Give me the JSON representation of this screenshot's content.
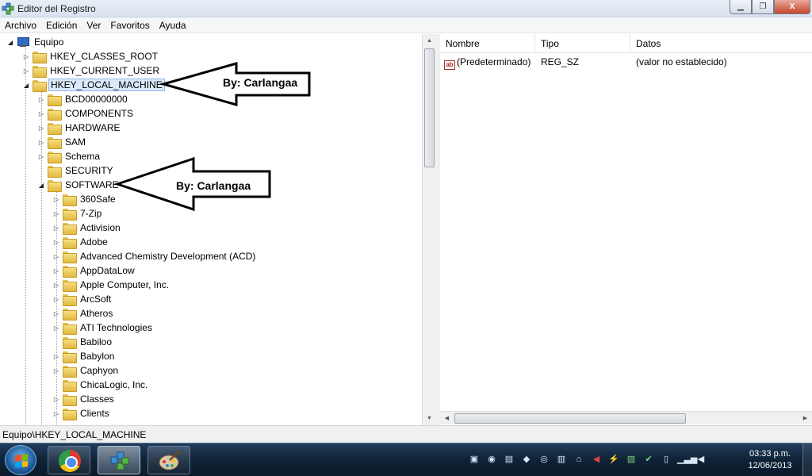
{
  "window": {
    "title": "Editor del Registro",
    "minimize": "▁",
    "maximize": "❐",
    "close": "X"
  },
  "menu": [
    "Archivo",
    "Edición",
    "Ver",
    "Favoritos",
    "Ayuda"
  ],
  "tree": {
    "root": "Equipo",
    "hives": [
      "HKEY_CLASSES_ROOT",
      "HKEY_CURRENT_USER",
      "HKEY_LOCAL_MACHINE"
    ],
    "local_machine_keys": [
      "BCD00000000",
      "COMPONENTS",
      "HARDWARE",
      "SAM",
      "Schema",
      "SECURITY",
      "SOFTWARE"
    ],
    "software_keys": [
      "360Safe",
      "7-Zip",
      "Activision",
      "Adobe",
      "Advanced Chemistry Development (ACD)",
      "AppDataLow",
      "Apple Computer, Inc.",
      "ArcSoft",
      "Atheros",
      "ATI Technologies",
      "Babiloo",
      "Babylon",
      "Caphyon",
      "ChicaLogic, Inc.",
      "Classes",
      "Clients"
    ]
  },
  "list": {
    "columns": [
      "Nombre",
      "Tipo",
      "Datos"
    ],
    "rows": [
      {
        "name": "(Predeterminado)",
        "type": "REG_SZ",
        "data": "(valor no establecido)",
        "icon": "string-value-icon"
      }
    ]
  },
  "annotations": [
    "By: Carlangaa",
    "By: Carlangaa"
  ],
  "status": "Equipo\\HKEY_LOCAL_MACHINE",
  "taskbar": {
    "apps": [
      "chrome-icon",
      "regedit-icon",
      "paint-icon"
    ],
    "clock_time": "03:33 p.m.",
    "clock_date": "12/06/2013"
  }
}
